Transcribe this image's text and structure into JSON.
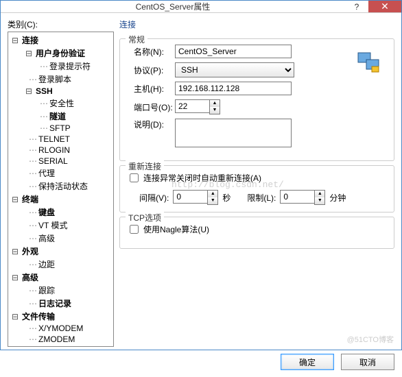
{
  "titlebar": {
    "title": "CentOS_Server属性"
  },
  "category_label": "类别(C):",
  "tree": {
    "connection": "连接",
    "user_auth": "用户身份验证",
    "logon_prompt": "登录提示符",
    "logon_script": "登录脚本",
    "ssh": "SSH",
    "security": "安全性",
    "tunnel": "隧道",
    "sftp": "SFTP",
    "telnet": "TELNET",
    "rlogin": "RLOGIN",
    "serial": "SERIAL",
    "proxy": "代理",
    "keepalive": "保持活动状态",
    "terminal": "终端",
    "keyboard": "键盘",
    "vt_mode": "VT 模式",
    "advanced_term": "高级",
    "appearance": "外观",
    "margin": "边距",
    "advanced": "高级",
    "trace": "跟踪",
    "logging": "日志记录",
    "file_transfer": "文件传输",
    "xymodem": "X/YMODEM",
    "zmodem": "ZMODEM"
  },
  "section": {
    "connection": "连接"
  },
  "general": {
    "legend": "常规",
    "name_label": "名称(N):",
    "name_value": "CentOS_Server",
    "protocol_label": "协议(P):",
    "protocol_value": "SSH",
    "host_label": "主机(H):",
    "host_value": "192.168.112.128",
    "port_label": "端口号(O):",
    "port_value": "22",
    "desc_label": "说明(D):",
    "desc_value": ""
  },
  "reconnect": {
    "legend": "重新连接",
    "checkbox_label": "连接异常关闭时自动重新连接(A)",
    "interval_label": "间隔(V):",
    "interval_value": "0",
    "seconds": "秒",
    "limit_label": "限制(L):",
    "limit_value": "0",
    "minutes": "分钟"
  },
  "tcp": {
    "legend": "TCP选项",
    "nagle_label": "使用Nagle算法(U)"
  },
  "footer": {
    "ok": "确定",
    "cancel": "取消"
  },
  "watermark": "http://blog.csdn.net/",
  "watermark2": "@51CTO博客"
}
